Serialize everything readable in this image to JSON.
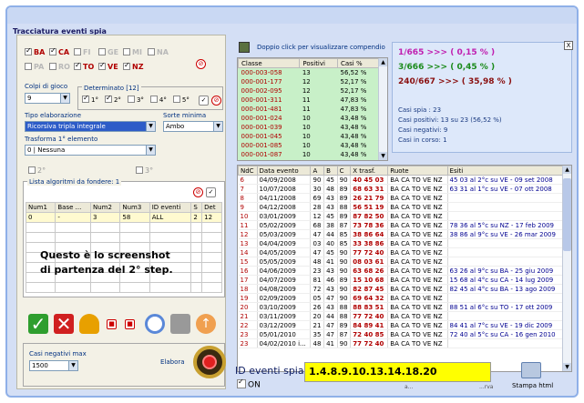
{
  "window": {
    "title": "Tracciatura eventi spia"
  },
  "wheels": [
    {
      "label": "BA",
      "on": true
    },
    {
      "label": "CA",
      "on": true
    },
    {
      "label": "FI",
      "on": false
    },
    {
      "label": "GE",
      "on": false
    },
    {
      "label": "MI",
      "on": false
    },
    {
      "label": "NA",
      "on": false
    },
    {
      "label": "PA",
      "on": false
    },
    {
      "label": "RO",
      "on": false
    },
    {
      "label": "TO",
      "on": true
    },
    {
      "label": "VE",
      "on": true
    },
    {
      "label": "NZ",
      "on": true
    }
  ],
  "settings": {
    "colpi_label": "Colpi di gioco",
    "colpi_value": "9",
    "determinato_label": "Determinato [12]",
    "determinato_items": [
      "1°",
      "2°",
      "3°",
      "4°",
      "5°"
    ],
    "tipo_label": "Tipo elaborazione",
    "tipo_value": "Ricorsiva tripla integrale",
    "sorte_label": "Sorte minima",
    "sorte_value": "Ambo",
    "trasforma_label": "Trasforma 1° elemento",
    "trasforma_value": "0 | Nessuna",
    "chk2": "2°",
    "chk3": "3°"
  },
  "lista": {
    "title": "Lista algoritmi da fondere: 1",
    "headers": [
      "Num1",
      "Base ...",
      "Num2",
      "Num3",
      "ID eventi",
      "S",
      "Det"
    ],
    "rows": [
      [
        "0",
        "-",
        "3",
        "58",
        "ALL",
        "2",
        "12"
      ]
    ]
  },
  "overlay": {
    "line1": "Questo è lo screenshot",
    "line2": "di partenza del 2° step."
  },
  "bottom": {
    "casi_label": "Casi negativi max",
    "casi_value": "1500",
    "elabora": "Elabora"
  },
  "compendio": {
    "hint": "Doppio click per visualizzare compendio",
    "headers": [
      "Classe",
      "Positivi",
      "Casi %"
    ],
    "rows": [
      [
        "000-003-058",
        "13",
        "56,52 %"
      ],
      [
        "000-001-177",
        "12",
        "52,17 %"
      ],
      [
        "000-002-095",
        "12",
        "52,17 %"
      ],
      [
        "000-001-311",
        "11",
        "47,83 %"
      ],
      [
        "000-001-481",
        "11",
        "47,83 %"
      ],
      [
        "000-001-024",
        "10",
        "43,48 %"
      ],
      [
        "000-001-039",
        "10",
        "43,48 %"
      ],
      [
        "000-001-045",
        "10",
        "43,48 %"
      ],
      [
        "000-001-085",
        "10",
        "43,48 %"
      ],
      [
        "000-001-087",
        "10",
        "43,48 %"
      ]
    ]
  },
  "stats": {
    "line1": "1/665 >>> ( 0,15 % )",
    "line2": "3/666 >>> ( 0,45 % )",
    "line3": "240/667 >>> ( 35,98 % )",
    "spia": "Casi spia : 23",
    "positivi": "Casi positivi: 13 su 23 (56,52 %)",
    "negativi": "Casi negativi: 9",
    "incorso": "Casi in corso: 1",
    "close": "X"
  },
  "events": {
    "headers": [
      "NdC",
      "Data evento",
      "A",
      "B",
      "C",
      "X trasf.",
      "Ruote",
      "Esiti"
    ],
    "rows": [
      [
        "6",
        "04/09/2008",
        "90",
        "45",
        "90",
        "40 45 03",
        "BA CA TO VE NZ",
        "45 03 al 2°c su VE - 09 set 2008"
      ],
      [
        "7",
        "10/07/2008",
        "30",
        "48",
        "89",
        "68 63 31",
        "BA CA TO VE NZ",
        "63 31 al 1°c su VE - 07 ott 2008"
      ],
      [
        "8",
        "04/11/2008",
        "69",
        "43",
        "89",
        "26 21 79",
        "BA CA TO VE NZ",
        ""
      ],
      [
        "9",
        "04/12/2008",
        "28",
        "43",
        "88",
        "56 51 19",
        "BA CA TO VE NZ",
        ""
      ],
      [
        "10",
        "03/01/2009",
        "12",
        "45",
        "89",
        "87 82 50",
        "BA CA TO VE NZ",
        ""
      ],
      [
        "11",
        "05/02/2009",
        "68",
        "38",
        "87",
        "73 78 36",
        "BA CA TO VE NZ",
        "78 36 al 5°c su NZ - 17 feb 2009"
      ],
      [
        "12",
        "05/03/2009",
        "47",
        "44",
        "85",
        "38 86 64",
        "BA CA TO VE NZ",
        "38 86 al 9°c su VE - 26 mar 2009"
      ],
      [
        "13",
        "04/04/2009",
        "03",
        "40",
        "85",
        "33 38 86",
        "BA CA TO VE NZ",
        ""
      ],
      [
        "14",
        "04/05/2009",
        "47",
        "45",
        "90",
        "77 72 40",
        "BA CA TO VE NZ",
        ""
      ],
      [
        "15",
        "05/05/2009",
        "48",
        "41",
        "90",
        "08 03 61",
        "BA CA TO VE NZ",
        ""
      ],
      [
        "16",
        "04/06/2009",
        "23",
        "43",
        "90",
        "63 68 26",
        "BA CA TO VE NZ",
        "63 26 al 9°c su BA - 25 giu 2009"
      ],
      [
        "17",
        "04/07/2009",
        "81",
        "46",
        "89",
        "15 10 68",
        "BA CA TO VE NZ",
        "15 68 al 4°c su CA - 14 lug 2009"
      ],
      [
        "18",
        "04/08/2009",
        "72",
        "43",
        "90",
        "82 87 45",
        "BA CA TO VE NZ",
        "82 45 al 4°c su BA - 13 ago 2009"
      ],
      [
        "19",
        "02/09/2009",
        "05",
        "47",
        "90",
        "69 64 32",
        "BA CA TO VE NZ",
        ""
      ],
      [
        "20",
        "03/10/2009",
        "26",
        "43",
        "88",
        "88 83 51",
        "BA CA TO VE NZ",
        "88 51 al 6°c su TO - 17 ott 2009"
      ],
      [
        "21",
        "03/11/2009",
        "20",
        "44",
        "88",
        "77 72 40",
        "BA CA TO VE NZ",
        ""
      ],
      [
        "22",
        "03/12/2009",
        "21",
        "47",
        "89",
        "84 89 41",
        "BA CA TO VE NZ",
        "84 41 al 7°c su VE - 19 dic 2009"
      ],
      [
        "23",
        "05/01/2010",
        "35",
        "47",
        "87",
        "72 40 85",
        "BA CA TO VE NZ",
        "72 40 al 5°c su CA - 16 gen 2010"
      ],
      [
        "23",
        "04/02/2010 i...",
        "48",
        "41",
        "90",
        "77 72 40",
        "BA CA TO VE NZ",
        ""
      ]
    ]
  },
  "idspia": {
    "label": "ID eventi spia",
    "value": "1.4.8.9.10.13.14.18.20",
    "on_label": "ON",
    "hidden1": "a...",
    "hidden2": "...rva",
    "stampa": "Stampa html"
  }
}
